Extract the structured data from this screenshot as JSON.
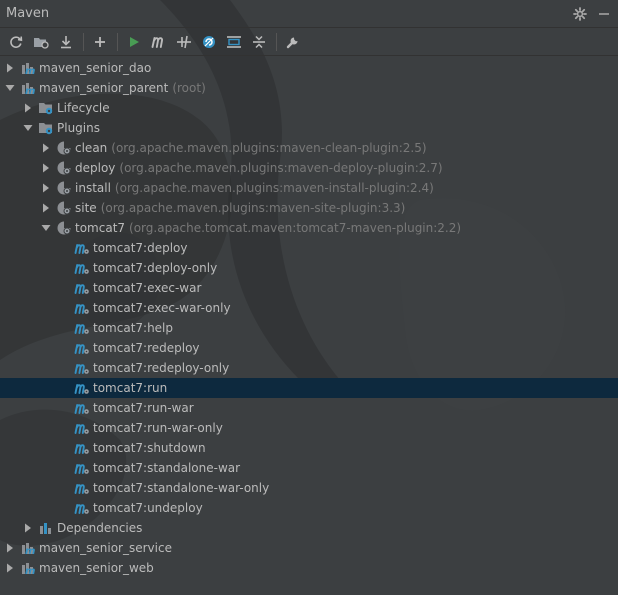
{
  "window": {
    "title": "Maven"
  },
  "title_icons": [
    "gear-icon",
    "minimize-icon"
  ],
  "toolbar": {
    "buttons": [
      {
        "name": "reimport-icon"
      },
      {
        "name": "generate-sources-icon"
      },
      {
        "name": "download-sources-icon"
      },
      {
        "name": "add-project-icon"
      },
      {
        "name": "run-icon"
      },
      {
        "name": "execute-goal-icon"
      },
      {
        "name": "toggle-offline-icon"
      },
      {
        "name": "skip-tests-icon"
      },
      {
        "name": "show-dependencies-icon"
      },
      {
        "name": "collapse-all-icon"
      },
      {
        "name": "settings-wrench-icon"
      }
    ]
  },
  "tree": {
    "items": [
      {
        "label": "maven_senior_dao",
        "sub": ""
      },
      {
        "label": "maven_senior_parent",
        "sub": "(root)"
      },
      {
        "label": "Lifecycle",
        "sub": ""
      },
      {
        "label": "Plugins",
        "sub": ""
      },
      {
        "label": "clean",
        "sub": "(org.apache.maven.plugins:maven-clean-plugin:2.5)"
      },
      {
        "label": "deploy",
        "sub": "(org.apache.maven.plugins:maven-deploy-plugin:2.7)"
      },
      {
        "label": "install",
        "sub": "(org.apache.maven.plugins:maven-install-plugin:2.4)"
      },
      {
        "label": "site",
        "sub": "(org.apache.maven.plugins:maven-site-plugin:3.3)"
      },
      {
        "label": "tomcat7",
        "sub": "(org.apache.tomcat.maven:tomcat7-maven-plugin:2.2)"
      },
      {
        "label": "tomcat7:deploy",
        "sub": ""
      },
      {
        "label": "tomcat7:deploy-only",
        "sub": ""
      },
      {
        "label": "tomcat7:exec-war",
        "sub": ""
      },
      {
        "label": "tomcat7:exec-war-only",
        "sub": ""
      },
      {
        "label": "tomcat7:help",
        "sub": ""
      },
      {
        "label": "tomcat7:redeploy",
        "sub": ""
      },
      {
        "label": "tomcat7:redeploy-only",
        "sub": ""
      },
      {
        "label": "tomcat7:run",
        "sub": ""
      },
      {
        "label": "tomcat7:run-war",
        "sub": ""
      },
      {
        "label": "tomcat7:run-war-only",
        "sub": ""
      },
      {
        "label": "tomcat7:shutdown",
        "sub": ""
      },
      {
        "label": "tomcat7:standalone-war",
        "sub": ""
      },
      {
        "label": "tomcat7:standalone-war-only",
        "sub": ""
      },
      {
        "label": "tomcat7:undeploy",
        "sub": ""
      },
      {
        "label": "Dependencies",
        "sub": ""
      },
      {
        "label": "maven_senior_service",
        "sub": ""
      },
      {
        "label": "maven_senior_web",
        "sub": ""
      }
    ],
    "selected_label": "tomcat7:run"
  },
  "colors": {
    "panel_bg": "#3c3f41",
    "selection": "#0d293e",
    "text": "#bbbbbb",
    "muted": "#787878",
    "run_green": "#499c54",
    "accent_blue": "#3592c4"
  }
}
